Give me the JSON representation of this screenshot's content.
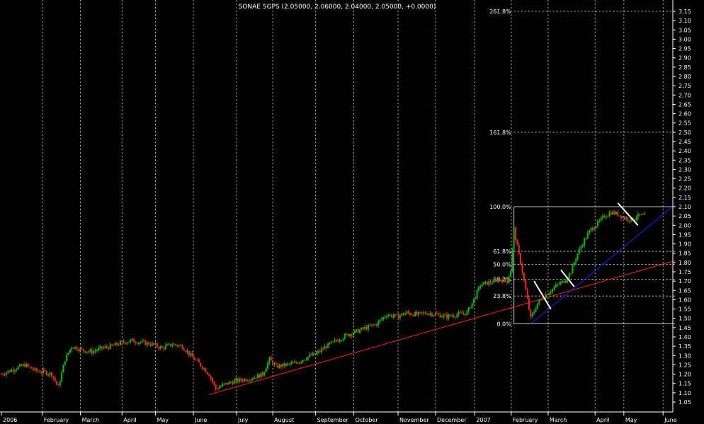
{
  "chart_data": {
    "type": "candlestick",
    "title": "SONAE SGPS (2.05000, 2.06000, 2.04000, 2.05000, +0.0000)",
    "ylim": [
      1.0,
      3.2
    ],
    "y_ticks": [
      "3.15",
      "3.10",
      "3.05",
      "3.00",
      "2.95",
      "2.90",
      "2.85",
      "2.80",
      "2.75",
      "2.70",
      "2.65",
      "2.60",
      "2.55",
      "2.50",
      "2.45",
      "2.40",
      "2.35",
      "2.30",
      "2.25",
      "2.20",
      "2.15",
      "2.10",
      "2.05",
      "2.00",
      "1.95",
      "1.90",
      "1.85",
      "1.80",
      "1.75",
      "1.70",
      "1.65",
      "1.60",
      "1.55",
      "1.50",
      "1.45",
      "1.40",
      "1.35",
      "1.30",
      "1.25",
      "1.20",
      "1.15",
      "1.10",
      "1.05"
    ],
    "month_labels": [
      "2006",
      "February",
      "March",
      "April",
      "May",
      "June",
      "July",
      "August",
      "September",
      "October",
      "November",
      "December",
      "2007",
      "February",
      "March",
      "April",
      "May",
      "June"
    ],
    "grid": true,
    "up_color": "#00c000",
    "down_color": "#ff2020",
    "price_path": [
      [
        0,
        1.2
      ],
      [
        4,
        1.23
      ],
      [
        7,
        1.25
      ],
      [
        10,
        1.22
      ],
      [
        13,
        1.21
      ],
      [
        15,
        1.2
      ],
      [
        17,
        1.13
      ],
      [
        19,
        1.28
      ],
      [
        21,
        1.35
      ],
      [
        24,
        1.33
      ],
      [
        27,
        1.32
      ],
      [
        30,
        1.34
      ],
      [
        33,
        1.35
      ],
      [
        36,
        1.37
      ],
      [
        39,
        1.38
      ],
      [
        42,
        1.37
      ],
      [
        45,
        1.36
      ],
      [
        48,
        1.34
      ],
      [
        51,
        1.36
      ],
      [
        54,
        1.35
      ],
      [
        57,
        1.29
      ],
      [
        60,
        1.24
      ],
      [
        62,
        1.2
      ],
      [
        64,
        1.12
      ],
      [
        66,
        1.14
      ],
      [
        69,
        1.16
      ],
      [
        72,
        1.17
      ],
      [
        75,
        1.18
      ],
      [
        78,
        1.2
      ],
      [
        80,
        1.28
      ],
      [
        82,
        1.24
      ],
      [
        85,
        1.25
      ],
      [
        88,
        1.26
      ],
      [
        91,
        1.29
      ],
      [
        94,
        1.31
      ],
      [
        97,
        1.35
      ],
      [
        100,
        1.38
      ],
      [
        103,
        1.41
      ],
      [
        106,
        1.43
      ],
      [
        109,
        1.45
      ],
      [
        112,
        1.47
      ],
      [
        115,
        1.52
      ],
      [
        118,
        1.51
      ],
      [
        121,
        1.53
      ],
      [
        124,
        1.52
      ],
      [
        127,
        1.53
      ],
      [
        130,
        1.52
      ],
      [
        133,
        1.51
      ],
      [
        136,
        1.52
      ],
      [
        139,
        1.53
      ],
      [
        141,
        1.6
      ],
      [
        143,
        1.68
      ],
      [
        145,
        1.69
      ],
      [
        147,
        1.7
      ],
      [
        149,
        1.71
      ],
      [
        151,
        1.7
      ],
      [
        152,
        1.76
      ],
      [
        153,
        1.98
      ],
      [
        154,
        1.88
      ],
      [
        155,
        1.8
      ],
      [
        156,
        1.7
      ],
      [
        157,
        1.6
      ],
      [
        158,
        1.5
      ],
      [
        160,
        1.58
      ],
      [
        162,
        1.62
      ],
      [
        164,
        1.65
      ],
      [
        166,
        1.68
      ],
      [
        168,
        1.7
      ],
      [
        170,
        1.75
      ],
      [
        172,
        1.85
      ],
      [
        174,
        1.92
      ],
      [
        176,
        1.98
      ],
      [
        178,
        2.01
      ],
      [
        180,
        2.05
      ],
      [
        182,
        2.07
      ],
      [
        184,
        2.06
      ],
      [
        186,
        2.04
      ],
      [
        188,
        2.03
      ],
      [
        190,
        2.05
      ],
      [
        192,
        2.05
      ]
    ],
    "fibonacci": {
      "levels": [
        {
          "label": "261.8%",
          "value": 3.15
        },
        {
          "label": "161.8%",
          "value": 2.5
        },
        {
          "label": "100.0%",
          "value": 2.1
        },
        {
          "label": "61.8%",
          "value": 1.86
        },
        {
          "label": "50.0%",
          "value": 1.79
        },
        {
          "label": "38.2%",
          "value": 1.71
        },
        {
          "label": "23.8%",
          "value": 1.62
        },
        {
          "label": "0.0%",
          "value": 1.47
        }
      ],
      "x_start": 153,
      "x_end": 201
    },
    "trendlines": [
      {
        "color": "#ff2020",
        "from": [
          62,
          1.09
        ],
        "to": [
          201,
          1.81
        ]
      },
      {
        "color": "#2020ff",
        "from": [
          158,
          1.47
        ],
        "to": [
          201,
          2.11
        ]
      },
      {
        "color": "#ffffff",
        "from": [
          159,
          1.7
        ],
        "to": [
          164,
          1.55
        ]
      },
      {
        "color": "#ffffff",
        "from": [
          167,
          1.76
        ],
        "to": [
          171,
          1.67
        ]
      },
      {
        "color": "#ffffff",
        "from": [
          184,
          2.12
        ],
        "to": [
          190,
          2.0
        ]
      }
    ]
  }
}
